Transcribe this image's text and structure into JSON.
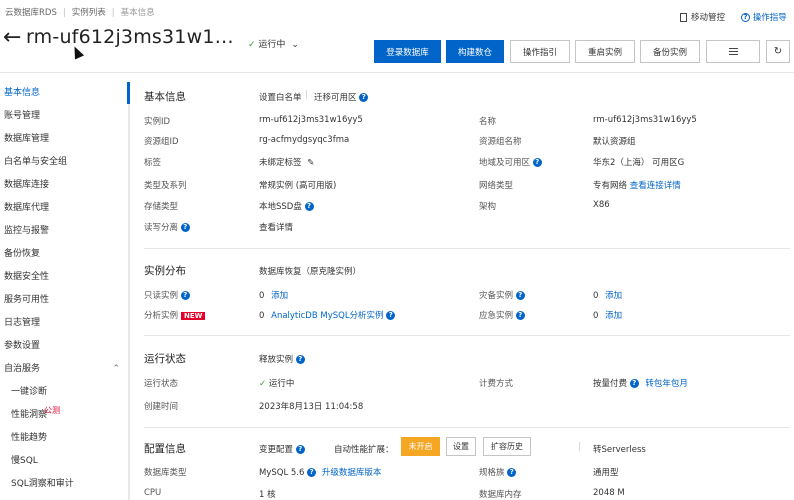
{
  "breadcrumb": [
    "云数据库RDS",
    "实例列表",
    "基本信息"
  ],
  "top_right": {
    "migrate": "移动管控",
    "guide": "操作指导"
  },
  "header": {
    "title": "rm-uf612j3ms31w1…",
    "status": "运行中"
  },
  "buttons": {
    "login": "登录数据库",
    "build": "构建数仓",
    "guide": "操作指引",
    "restart": "重启实例",
    "backup": "备份实例"
  },
  "sidebar": {
    "items": [
      "基本信息",
      "账号管理",
      "数据库管理",
      "白名单与安全组",
      "数据库连接",
      "数据库代理",
      "监控与报警",
      "备份恢复",
      "数据安全性",
      "服务可用性",
      "日志管理",
      "参数设置",
      "自治服务"
    ],
    "sub_items": [
      "一键诊断",
      "性能洞察",
      "性能趋势",
      "慢SQL",
      "SQL洞察和审计"
    ],
    "beta": "公测"
  },
  "basic": {
    "title": "基本信息",
    "whitelist": "设置白名单",
    "migrate": "迁移可用区",
    "rows": [
      {
        "k": "实例ID",
        "v": "rm-uf612j3ms31w16yy5",
        "k2": "名称",
        "v2": "rm-uf612j3ms31w16yy5"
      },
      {
        "k": "资源组ID",
        "v": "rg-acfmydgsyqc3fma",
        "k2": "资源组名称",
        "v2": "默认资源组"
      },
      {
        "k": "标签",
        "v": "未绑定标签",
        "k2": "地域及可用区",
        "v2": "华东2（上海） 可用区G"
      },
      {
        "k": "类型及系列",
        "v": "常规实例 (高可用版)",
        "k2": "网络类型",
        "v2": "专有网络"
      },
      {
        "k": "存储类型",
        "v": "本地SSD盘",
        "k2": "架构",
        "v2": "X86"
      },
      {
        "k": "读写分离",
        "v": "查看详情"
      }
    ],
    "network_link": "查看连接详情"
  },
  "dist": {
    "title": "实例分布",
    "restore": "数据库恢复（原克隆实例）",
    "readonly": "只读实例",
    "readonly_count": "0",
    "add": "添加",
    "standby": "灾备实例",
    "standby_count": "0",
    "analytic": "分析实例",
    "new": "NEW",
    "analytic_count": "0",
    "analytic_link": "AnalyticDB MySQL分析实例",
    "emergency": "应急实例",
    "emergency_count": "0"
  },
  "run": {
    "title": "运行状态",
    "release": "释放实例",
    "status_k": "运行状态",
    "status_v": "运行中",
    "billing_k": "计费方式",
    "billing_v": "按量付费",
    "billing_link": "转包年包月",
    "created_k": "创建时间",
    "created_v": "2023年8月13日 11:04:58"
  },
  "config": {
    "title": "配置信息",
    "change": "变更配置",
    "autoscale": "自动性能扩展：",
    "off": "未开启",
    "setting": "设置",
    "history": "扩容历史",
    "serverless": "转Serverless",
    "dbtype_k": "数据库类型",
    "dbtype_v": "MySQL  5.6",
    "upgrade": "升级数据库版本",
    "spec_k": "规格族",
    "spec_v": "通用型",
    "cpu_k": "CPU",
    "cpu_v": "1 核",
    "mem_k": "数据库内存",
    "mem_v": "2048 M"
  }
}
